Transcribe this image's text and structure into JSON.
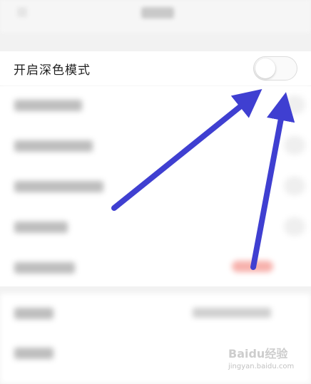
{
  "settings": {
    "dark_mode_label": "开启深色模式",
    "dark_mode_enabled": false
  },
  "watermark": {
    "brand": "Baidu经验",
    "url": "jingyan.baidu.com"
  },
  "colors": {
    "arrow": "#3f3fd1",
    "toggle_off": "#fafafa",
    "row_bg": "#ffffff"
  }
}
